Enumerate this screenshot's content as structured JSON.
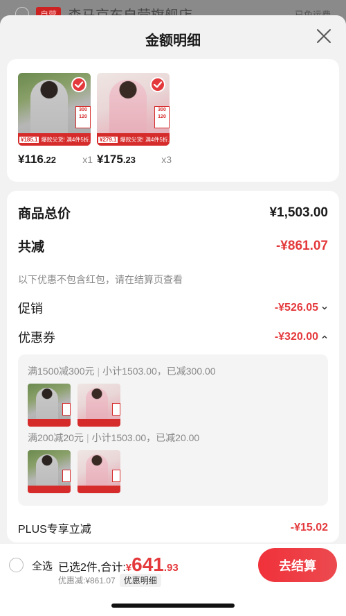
{
  "background": {
    "store_tag": "自营",
    "store_name": "森马京东自营旗舰店",
    "shipping": "已免运费"
  },
  "sheet": {
    "title": "金额明细",
    "close_icon": "close-icon"
  },
  "products": [
    {
      "price_main": "¥116",
      "price_cents": ".22",
      "qty": "x1",
      "badge_price": "¥185.1",
      "promo": "爆款尖货! 满4件5折.",
      "theme": "grey"
    },
    {
      "price_main": "¥175",
      "price_cents": ".23",
      "qty": "x3",
      "badge_price": "¥279.1",
      "promo": "爆款尖货! 满4件5折.",
      "theme": "pink"
    }
  ],
  "detail": {
    "total_label": "商品总价",
    "total_value": "¥1,503.00",
    "reduce_label": "共减",
    "reduce_value": "-¥861.07",
    "note": "以下优惠不包含红包，请在结算页查看",
    "promo_label": "促销",
    "promo_value": "-¥526.05",
    "coupon_label": "优惠券",
    "coupon_value": "-¥320.00",
    "coupon_lines": [
      {
        "rule": "满1500减300元",
        "subtotal": "小计1503.00，已减300.00"
      },
      {
        "rule": "满200减20元",
        "subtotal": "小计1503.00，已减20.00"
      }
    ],
    "plus_label": "PLUS专享立减",
    "plus_value": "-¥15.02"
  },
  "bottom": {
    "select_all": "全选",
    "selected_text": "已选2件,合计:",
    "yen": "¥",
    "total_big": "641",
    "total_cents": ".93",
    "discount_text": "优惠减:¥861.07",
    "detail_link": "优惠明细",
    "checkout": "去结算"
  },
  "colors": {
    "accent": "#e4393c",
    "sheet_bg": "#f2f2f2"
  }
}
